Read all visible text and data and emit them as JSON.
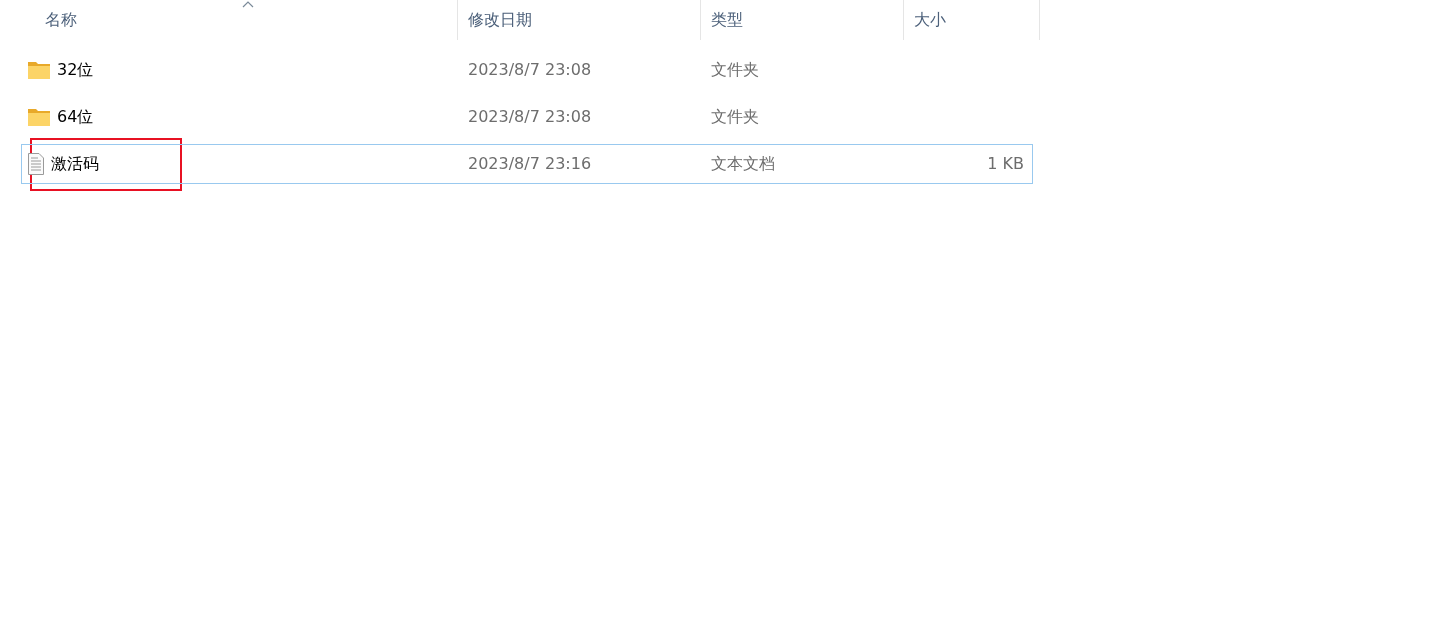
{
  "columns": [
    {
      "label": "名称",
      "sorted": true
    },
    {
      "label": "修改日期",
      "sorted": false
    },
    {
      "label": "类型",
      "sorted": false
    },
    {
      "label": "大小",
      "sorted": false
    }
  ],
  "rows": [
    {
      "kind": "folder",
      "name": "32位",
      "modified": "2023/8/7 23:08",
      "type": "文件夹",
      "focused": false,
      "highlighted": false
    },
    {
      "kind": "folder",
      "name": "64位",
      "modified": "2023/8/7 23:08",
      "type": "文件夹",
      "focused": false,
      "highlighted": false
    },
    {
      "kind": "text-file",
      "name": "激活码",
      "modified": "2023/8/7 23:16",
      "type": "文本文档",
      "size": "1 KB",
      "focused": true,
      "highlighted": true
    }
  ]
}
